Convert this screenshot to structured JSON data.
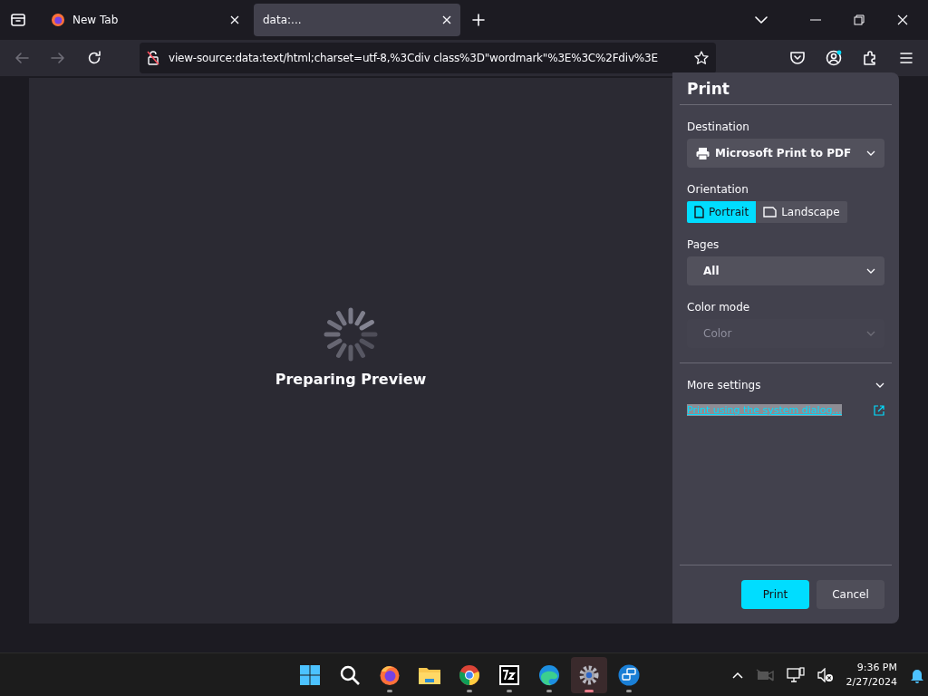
{
  "tabs": [
    {
      "title": "New Tab",
      "selected": false,
      "kind": "firefox"
    },
    {
      "title": "data:...",
      "selected": true,
      "kind": "blank"
    }
  ],
  "address_bar": {
    "value": "view-source:data:text/html;charset=utf-8,%3Cdiv class%3D\"wordmark\"%3E%3C%2Fdiv%3E"
  },
  "preview": {
    "message": "Preparing Preview"
  },
  "print_panel": {
    "title": "Print",
    "destination": {
      "label": "Destination",
      "value": "Microsoft Print to PDF"
    },
    "orientation": {
      "label": "Orientation",
      "options": [
        {
          "label": "Portrait",
          "kind": "portrait",
          "selected": true
        },
        {
          "label": "Landscape",
          "kind": "landscape",
          "selected": false
        }
      ]
    },
    "pages": {
      "label": "Pages",
      "value": "All"
    },
    "color_mode": {
      "label": "Color mode",
      "value": "Color",
      "disabled": true
    },
    "more_settings": {
      "label": "More settings",
      "expanded": false
    },
    "system_dialog_link": {
      "label": "Print using the system dialog...",
      "selected": true
    },
    "buttons": [
      {
        "label": "Print",
        "kind": "primary"
      },
      {
        "label": "Cancel",
        "kind": "secondary"
      }
    ]
  },
  "taskbar": {
    "apps": [
      {
        "kind": "start",
        "running": false,
        "active": false
      },
      {
        "kind": "search",
        "running": false,
        "active": false
      },
      {
        "kind": "firefox",
        "running": true,
        "active": false
      },
      {
        "kind": "folder",
        "running": false,
        "active": false
      },
      {
        "kind": "chrome",
        "running": true,
        "active": false
      },
      {
        "kind": "archiver",
        "running": true,
        "active": false
      },
      {
        "kind": "edge",
        "running": true,
        "active": false
      },
      {
        "kind": "settings",
        "running": true,
        "active": true
      },
      {
        "kind": "remote",
        "running": true,
        "active": false
      }
    ],
    "time": "9:36 PM",
    "date": "2/27/2024"
  }
}
